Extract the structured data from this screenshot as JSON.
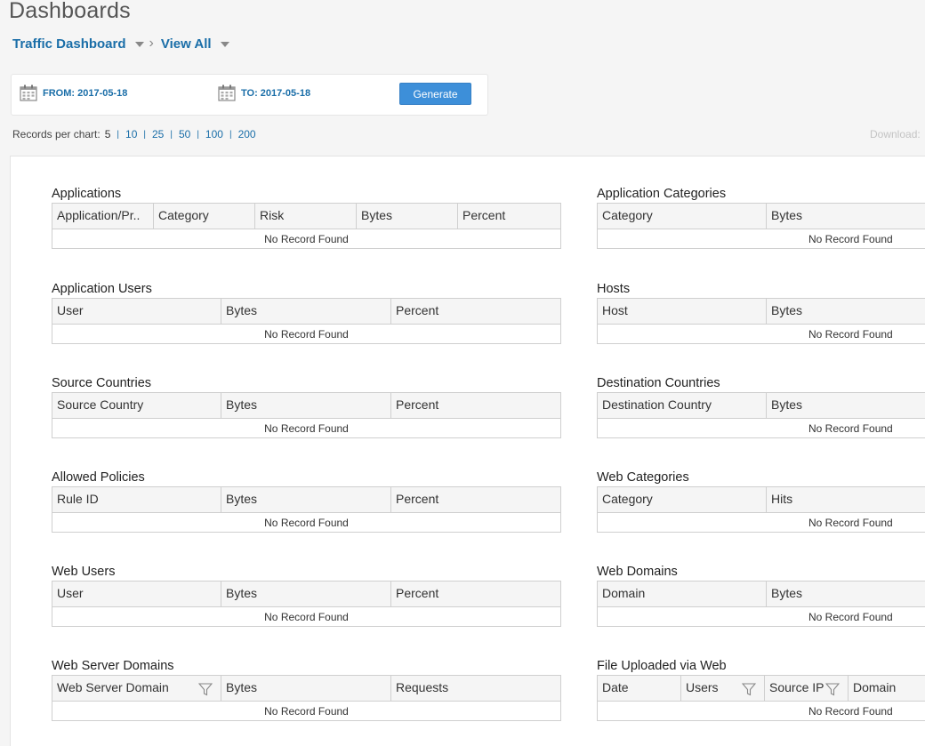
{
  "page_title": "Dashboards",
  "breadcrumb": {
    "dashboard": "Traffic Dashboard",
    "view": "View All"
  },
  "date_bar": {
    "from_label": "FROM: 2017-05-18",
    "to_label": "TO: 2017-05-18",
    "generate": "Generate"
  },
  "records": {
    "label": "Records per chart:",
    "selected": "5",
    "options": [
      "10",
      "25",
      "50",
      "100",
      "200"
    ]
  },
  "download": "Download:",
  "empty_text": "No Record Found",
  "widgets": {
    "applications": {
      "title": "Applications",
      "columns": [
        "Application/Pr..",
        "Category",
        "Risk",
        "Bytes",
        "Percent"
      ]
    },
    "app_categories": {
      "title": "Application Categories",
      "columns": [
        "Category",
        "Bytes"
      ]
    },
    "app_users": {
      "title": "Application Users",
      "columns": [
        "User",
        "Bytes",
        "Percent"
      ]
    },
    "hosts": {
      "title": "Hosts",
      "columns": [
        "Host",
        "Bytes"
      ]
    },
    "source_countries": {
      "title": "Source Countries",
      "columns": [
        "Source Country",
        "Bytes",
        "Percent"
      ]
    },
    "destination_countries": {
      "title": "Destination Countries",
      "columns": [
        "Destination Country",
        "Bytes"
      ]
    },
    "allowed_policies": {
      "title": "Allowed Policies",
      "columns": [
        "Rule ID",
        "Bytes",
        "Percent"
      ]
    },
    "web_categories": {
      "title": "Web Categories",
      "columns": [
        "Category",
        "Hits"
      ]
    },
    "web_users": {
      "title": "Web Users",
      "columns": [
        "User",
        "Bytes",
        "Percent"
      ]
    },
    "web_domains": {
      "title": "Web Domains",
      "columns": [
        "Domain",
        "Bytes"
      ]
    },
    "web_server_domains": {
      "title": "Web Server Domains",
      "columns": [
        "Web Server Domain",
        "Bytes",
        "Requests"
      ]
    },
    "file_uploaded": {
      "title": "File Uploaded via Web",
      "columns": [
        "Date",
        "Users",
        "Source IP",
        "Domain"
      ]
    }
  }
}
